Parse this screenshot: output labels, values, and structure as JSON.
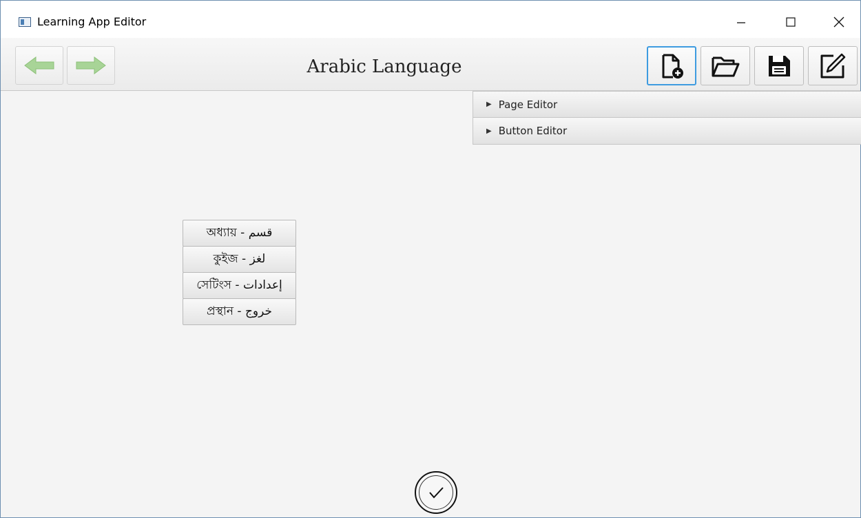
{
  "window": {
    "title": "Learning App Editor",
    "controls": [
      "minimize-icon",
      "maximize-icon",
      "close-icon"
    ]
  },
  "toolbar": {
    "page_title": "Arabic Language",
    "nav": [
      {
        "name": "back-arrow-icon",
        "color": "#7fbf6a"
      },
      {
        "name": "forward-arrow-icon",
        "color": "#7fbf6a"
      }
    ],
    "tools": [
      "new-file-icon",
      "open-folder-icon",
      "save-icon",
      "edit-icon"
    ],
    "active_tool_border": "#3d9be0"
  },
  "editors": [
    {
      "label": "Page Editor"
    },
    {
      "label": "Button Editor"
    }
  ],
  "menu_buttons": [
    {
      "label": "অধ্যায় - قسم"
    },
    {
      "label": "কুইজ - لغز"
    },
    {
      "label": "সেটিংস - إعدادات"
    },
    {
      "label": "প্রস্থান - خروج"
    }
  ],
  "confirm": {
    "icon": "checkmark-icon"
  }
}
